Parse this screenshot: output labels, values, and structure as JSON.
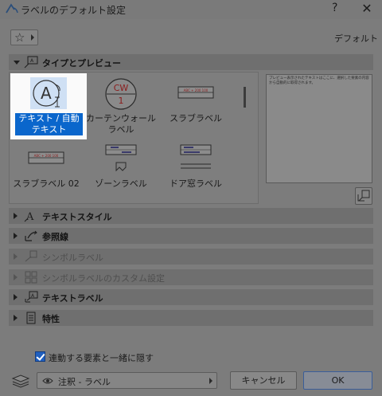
{
  "window": {
    "title": "ラベルのデフォルト設定",
    "help": "?",
    "close": "✕"
  },
  "toolbar": {
    "favorites_icon": "star-icon",
    "default_label": "デフォルト"
  },
  "sections": {
    "type_preview": "タイプとプレビュー",
    "text_style": "テキストスタイル",
    "pointer": "参照線",
    "symbol_label": "シンボルラベル",
    "symbol_custom": "シンボルラベルのカスタム設定",
    "text_label": "テキストラベル",
    "properties": "特性"
  },
  "gallery": {
    "items": [
      {
        "label": "テキスト / 自動テキスト",
        "selected": true
      },
      {
        "label": "カーテンウォールラベル",
        "badge_top": "CW",
        "badge_bottom": "1"
      },
      {
        "label": "スラブラベル",
        "tag": "ABC + 200 100"
      },
      {
        "label": "スラブラベル 02",
        "tag": "ABC + 200 100"
      },
      {
        "label": "ゾーンラベル"
      },
      {
        "label": "ドア窓ラベル"
      }
    ]
  },
  "preview": {
    "text": "プレビュー表示されたテキストはここに、選択した要素の内容から自動的に取得されます。"
  },
  "options": {
    "hide_with_element": "連動する要素と一緒に隠す",
    "hide_with_element_checked": true
  },
  "footer": {
    "layer": "注釈 - ラベル",
    "cancel": "キャンセル",
    "ok": "OK"
  }
}
